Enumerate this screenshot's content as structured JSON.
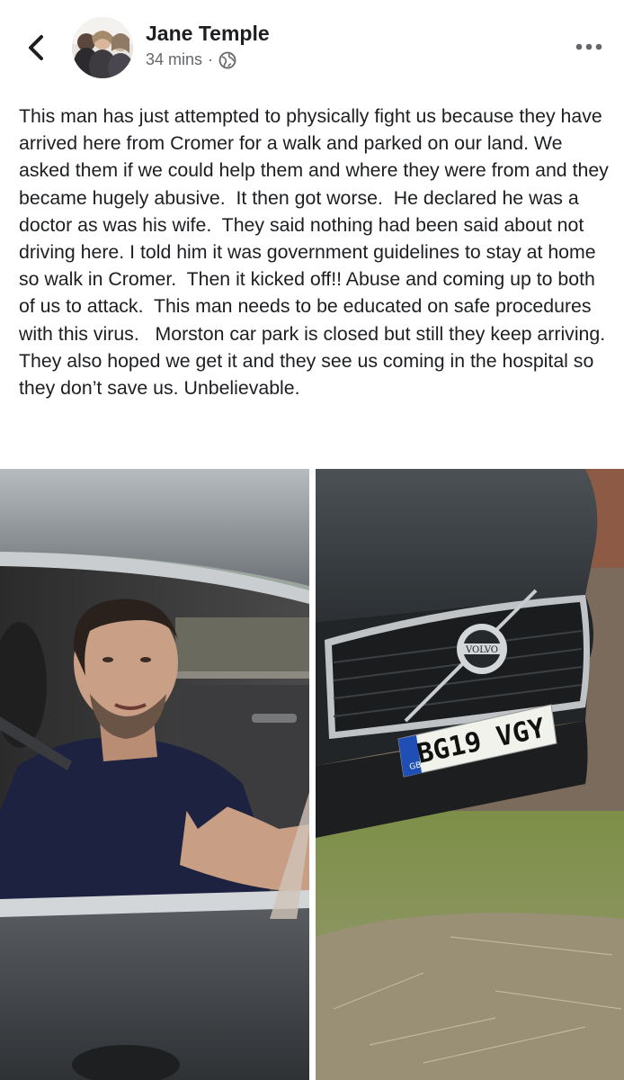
{
  "header": {
    "back_icon": "chevron-left-icon",
    "author_name": "Jane Temple",
    "timestamp": "34 mins",
    "separator": "·",
    "privacy_icon": "globe-icon",
    "more_icon": "more-horizontal-icon"
  },
  "post": {
    "text": "This man has just attempted to physically fight us because they have arrived here from Cromer for a walk and parked on our land. We asked them if we could help them and where they were from and they became hugely abusive.  It then got worse.  He declared he was a doctor as was his wife.  They said nothing had been said about not driving here. I told him it was government guidelines to stay at home so walk in Cromer.  Then it kicked off!! Abuse and coming up to both of us to attack.  This man needs to be educated on safe procedures with this virus.   Morston car park is closed but still they keep arriving.  They also hoped we get it and they see us coming in the hospital so they don’t save us. Unbelievable."
  },
  "photos": {
    "left": {
      "subject": "man-in-car-photo"
    },
    "right": {
      "subject": "car-front-photo",
      "badge_text": "VOLVO",
      "plate_text": "BG19 VGY",
      "plate_country": "GB"
    }
  },
  "colors": {
    "text_primary": "#1c1e21",
    "text_secondary": "#65676b",
    "plate_yellow": "#f2f2ec",
    "eu_blue": "#1f4fb4"
  }
}
